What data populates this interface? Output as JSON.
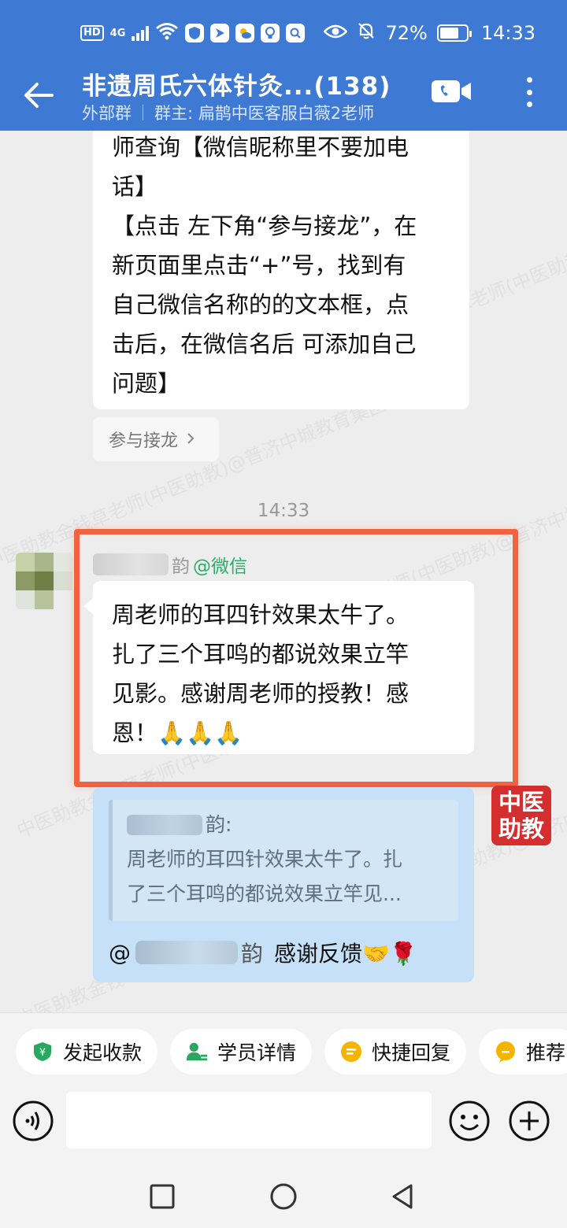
{
  "status_bar": {
    "hd": "HD",
    "network": "4G",
    "battery_percent_text": "72%",
    "battery_level": 0.72,
    "time": "14:33"
  },
  "header": {
    "title": "非遗周氏六体针灸...(138)",
    "group_type": "外部群",
    "owner": "群主: 扁鹊中医客服白薇2老师"
  },
  "messages": {
    "top_bubble_text": "师查询【微信昵称里不要加电\n话】\n【点击 左下角“参与接龙”，在\n新页面里点击“+”号，找到有\n自己微信名称的的文本框，点\n击后，在微信名后 可添加自己\n问题】",
    "join_button": "参与接龙",
    "timestamp": "14:33",
    "sender_name_partial": "韵",
    "sender_tag": "@微信",
    "main_text": "周老师的耳四针效果太牛了。\n扎了三个耳鸣的都说效果立竿\n见影。感谢周老师的授教！感\n恩！🙏🙏🙏",
    "quote_name_partial": "韵:",
    "quote_text": "周老师的耳四针效果太牛了。扎\n了三个耳鸣的都说效果立竿见...",
    "reply_at": "@",
    "reply_name_end": "韵",
    "reply_text": "感谢反馈🤝🌹"
  },
  "badge": {
    "line1": "中医",
    "line2": "助教"
  },
  "watermark_text": "中医助教金钱草老师(中医助教)@普济中城教育集团653",
  "quick_actions": [
    {
      "label": "发起收款",
      "icon": "payment-icon"
    },
    {
      "label": "学员详情",
      "icon": "student-icon"
    },
    {
      "label": "快捷回复",
      "icon": "quick-reply-icon"
    },
    {
      "label": "推荐",
      "icon": "recommend-icon"
    }
  ],
  "colors": {
    "header_blue": "#3e7ad3",
    "highlight": "#f2623e",
    "reply_bubble": "#c5e0f7",
    "badge_red": "#d32f2f",
    "wechat_green": "#2aae67",
    "quick_green": "#27a85e",
    "quick_yellow": "#f4b400"
  }
}
